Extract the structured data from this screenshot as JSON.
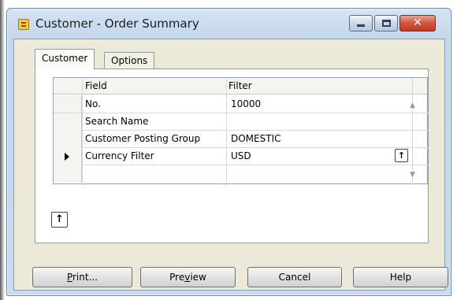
{
  "window": {
    "title": "Customer - Order Summary",
    "icon": "form-icon",
    "controls": [
      "minimize-icon",
      "maximize-icon",
      "close-icon"
    ]
  },
  "tabs": [
    {
      "label": "Customer",
      "active": true
    },
    {
      "label": "Options",
      "active": false
    }
  ],
  "grid": {
    "columns": [
      "Field",
      "Filter"
    ],
    "rows": [
      {
        "field": "No.",
        "filter": "10000",
        "current": false
      },
      {
        "field": "Search Name",
        "filter": "",
        "current": false
      },
      {
        "field": "Customer Posting Group",
        "filter": "DOMESTIC",
        "current": false
      },
      {
        "field": "Currency Filter",
        "filter": "USD",
        "current": true
      },
      {
        "field": "",
        "filter": "",
        "current": false
      }
    ]
  },
  "buttons": {
    "print_key": "P",
    "print_rest": "rint...",
    "preview_a": "Pre",
    "preview_key": "v",
    "preview_b": "iew",
    "cancel": "Cancel",
    "help": "Help"
  },
  "colors": {
    "titlebar": "#c3d6ec",
    "client": "#ece9d8",
    "close_button": "#c23b22"
  }
}
